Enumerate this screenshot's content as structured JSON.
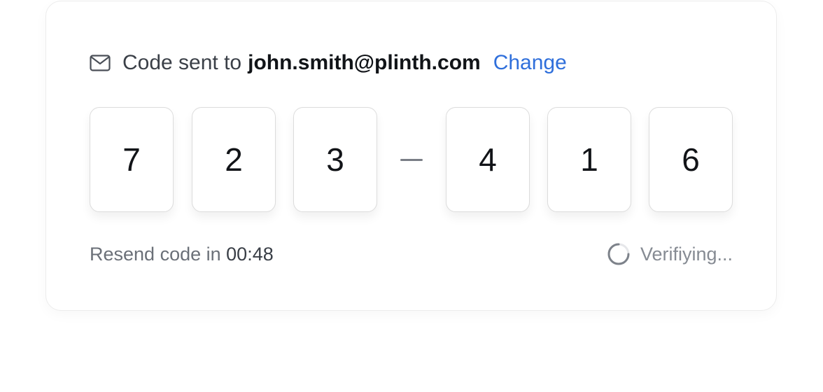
{
  "verification": {
    "sent_prefix": "Code sent to",
    "email": "john.smith@plinth.com",
    "change_label": "Change",
    "digits": [
      "7",
      "2",
      "3",
      "4",
      "1",
      "6"
    ],
    "resend_prefix": "Resend code in",
    "timer": "00:48",
    "status": "Verifiying..."
  },
  "icons": {
    "mail": "mail-icon",
    "spinner": "spinner-icon"
  },
  "colors": {
    "link": "#2f6fdb",
    "text": "#3a3f47",
    "muted": "#6b7078"
  }
}
